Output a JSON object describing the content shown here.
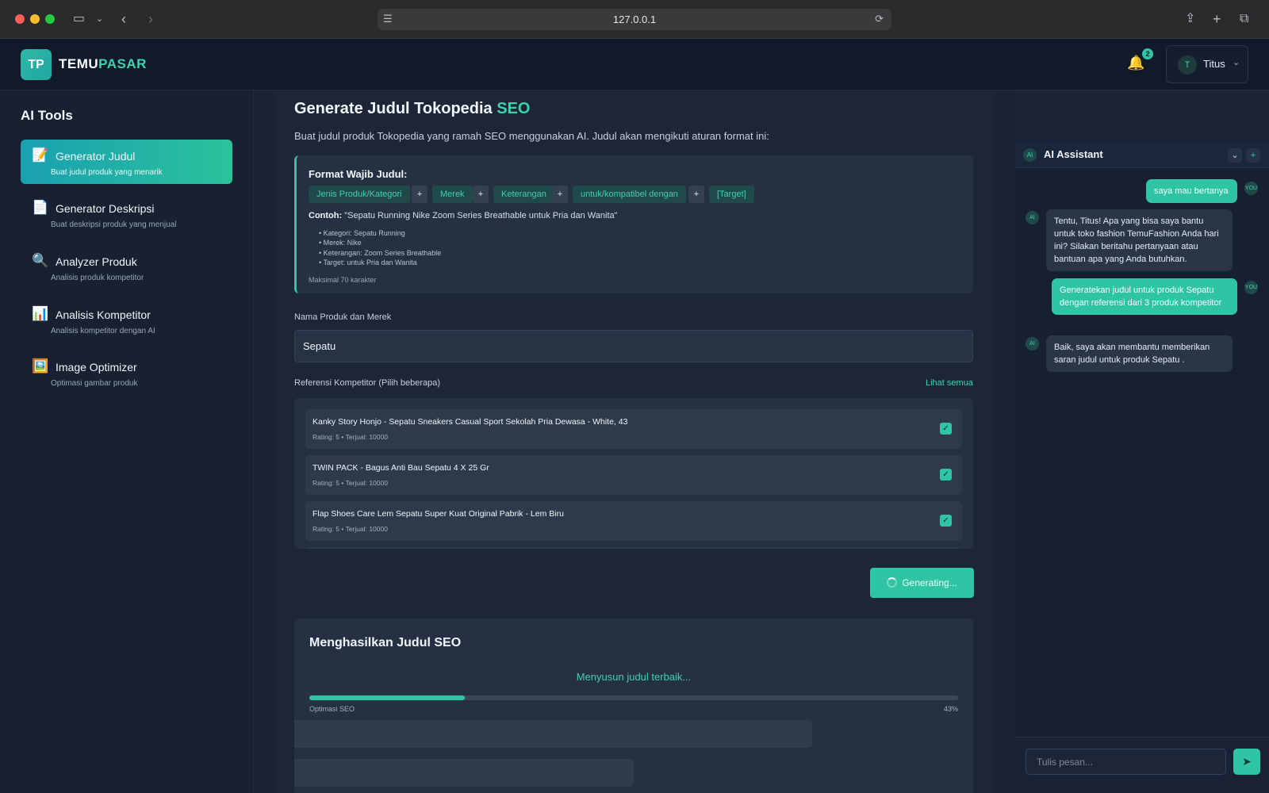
{
  "browser": {
    "url": "127.0.0.1"
  },
  "header": {
    "logo_initials": "TP",
    "brand_part1": "TEMU",
    "brand_part2": "PASAR",
    "notification_count": "2",
    "user_initial": "T",
    "user_name": "Titus"
  },
  "sidebar": {
    "title": "AI Tools",
    "items": [
      {
        "icon": "📝",
        "name": "Generator Judul",
        "desc": "Buat judul produk yang menarik",
        "active": true
      },
      {
        "icon": "📄",
        "name": "Generator Deskripsi",
        "desc": "Buat deskripsi produk yang menjual",
        "active": false
      },
      {
        "icon": "🔍",
        "name": "Analyzer Produk",
        "desc": "Analisis produk kompetitor",
        "active": false
      },
      {
        "icon": "📊",
        "name": "Analisis Kompetitor",
        "desc": "Analisis kompetitor dengan AI",
        "active": false
      },
      {
        "icon": "🖼️",
        "name": "Image Optimizer",
        "desc": "Optimasi gambar produk",
        "active": false
      }
    ]
  },
  "main": {
    "title_main": "Generate Judul Tokopedia",
    "title_accent": "SEO",
    "subtitle": "Buat judul produk Tokopedia yang ramah SEO menggunakan AI. Judul akan mengikuti aturan format ini:",
    "format": {
      "title": "Format Wajib Judul:",
      "chips": [
        "Jenis Produk/Kategori",
        "Merek",
        "Keterangan",
        "untuk/kompatibel dengan",
        "[Target]"
      ],
      "plus": "+",
      "example_label": "Contoh:",
      "example_text": "\"Sepatu Running Nike Zoom Series Breathable untuk Pria dan Wanita\"",
      "bullets": [
        "• Kategori: Sepatu Running",
        "• Merek: Nike",
        "• Keterangan: Zoom Series Breathable",
        "• Target: untuk Pria dan Wanita"
      ],
      "max": "Maksimal 70 karakter"
    },
    "product_label": "Nama Produk dan Merek",
    "product_value": "Sepatu",
    "ref_label": "Referensi Kompetitor (Pilih beberapa)",
    "ref_link": "Lihat semua",
    "refs": [
      {
        "title": "Kanky Story Honjo - Sepatu Sneakers Casual Sport Sekolah Pria Dewasa - White, 43",
        "meta": "Rating: 5 • Terjual: 10000",
        "checked": true
      },
      {
        "title": "TWIN PACK - Bagus Anti Bau Sepatu 4 X 25 Gr",
        "meta": "Rating: 5 • Terjual: 10000",
        "checked": true
      },
      {
        "title": "Flap Shoes Care Lem Sepatu Super Kuat Original Pabrik - Lem Biru",
        "meta": "Rating: 5 • Terjual: 10000",
        "checked": true
      }
    ],
    "generate_button": "Generating...",
    "result": {
      "title": "Menghasilkan Judul SEO",
      "status": "Menyusun judul terbaik...",
      "progress_label": "Optimasi SEO",
      "progress_pct": "43%",
      "progress_value": 0.24
    }
  },
  "assistant": {
    "title": "AI Assistant",
    "ai_tag": "AI",
    "you_tag": "YOU",
    "messages": [
      {
        "role": "user",
        "text": "saya mau bertanya"
      },
      {
        "role": "ai",
        "text": "Tentu, Titus! Apa yang bisa saya bantu untuk toko fashion TemuFashion Anda hari ini? Silakan beritahu pertanyaan atau bantuan apa yang Anda butuhkan."
      },
      {
        "role": "user",
        "text": "Generatekan judul untuk produk Sepatu dengan referensi dari 3 produk kompetitor"
      },
      {
        "role": "ai",
        "text": "Baik, saya akan membantu memberikan saran judul untuk produk Sepatu ."
      }
    ],
    "input_placeholder": "Tulis pesan..."
  },
  "colors": {
    "accent": "#2ec4a4",
    "background": "#1a2333"
  }
}
